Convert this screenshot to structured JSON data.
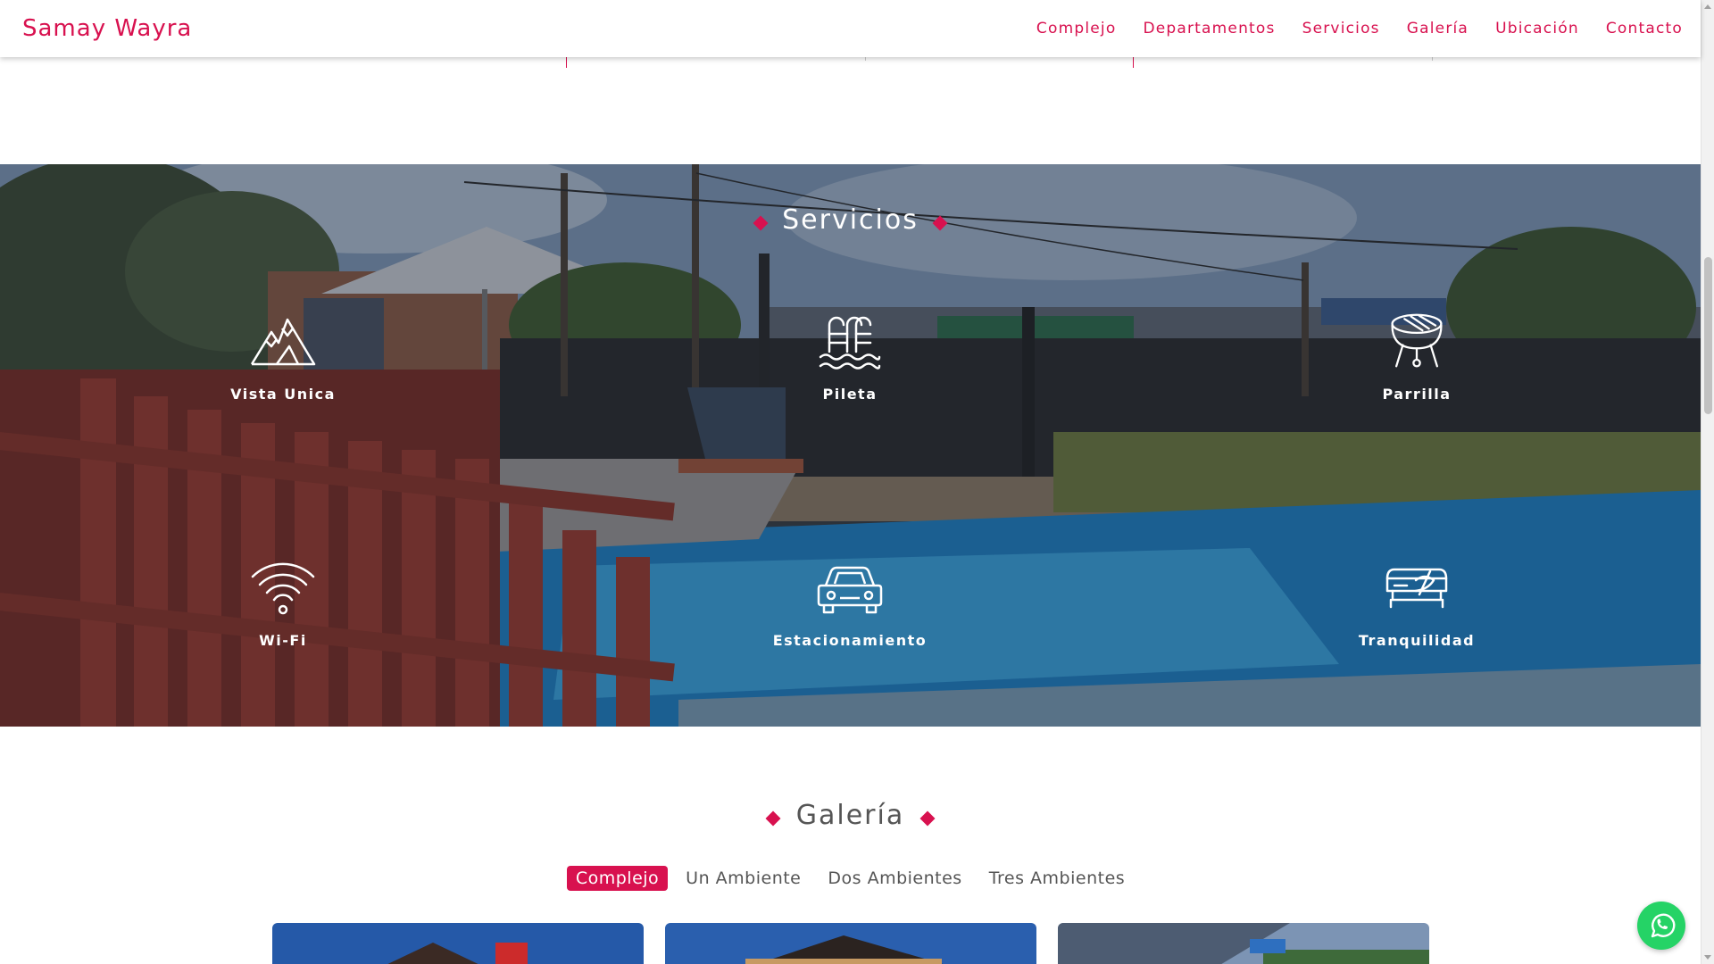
{
  "brand": {
    "name": "Samay Wayra"
  },
  "nav": {
    "items": [
      "Complejo",
      "Departamentos",
      "Servicios",
      "Galería",
      "Ubicación",
      "Contacto"
    ]
  },
  "services": {
    "title": "Servicios",
    "items": [
      {
        "label": "Vista Unica",
        "icon": "mountain-icon"
      },
      {
        "label": "Pileta",
        "icon": "pool-icon"
      },
      {
        "label": "Parrilla",
        "icon": "grill-icon"
      },
      {
        "label": "Wi-Fi",
        "icon": "wifi-icon"
      },
      {
        "label": "Estacionamiento",
        "icon": "car-icon"
      },
      {
        "label": "Tranquilidad",
        "icon": "bed-icon"
      }
    ]
  },
  "gallery": {
    "title": "Galería",
    "tabs": [
      "Complejo",
      "Un Ambiente",
      "Dos Ambientes",
      "Tres Ambientes"
    ],
    "active_tab": "Complejo"
  },
  "colors": {
    "accent": "#d8114f",
    "heading_gray": "#555555",
    "whatsapp": "#25d366"
  },
  "floating": {
    "whatsapp_icon": "whatsapp-icon"
  }
}
